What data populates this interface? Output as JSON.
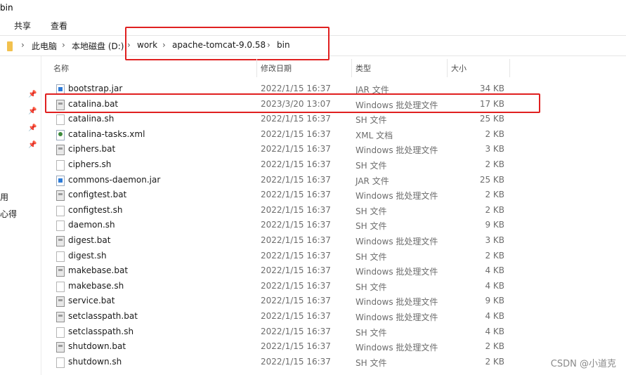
{
  "window": {
    "title": "bin"
  },
  "ribbon": {
    "tabs": [
      "共享",
      "查看"
    ]
  },
  "address": {
    "crumbs": [
      "此电脑",
      "本地磁盘 (D:)",
      "work",
      "apache-tomcat-9.0.58",
      "bin"
    ]
  },
  "nav": {
    "labels": [
      "用",
      "心得"
    ]
  },
  "columns": {
    "name": "名称",
    "date": "修改日期",
    "type": "类型",
    "size": "大小"
  },
  "files": [
    {
      "name": "bootstrap.jar",
      "date": "2022/1/15 16:37",
      "type": "JAR 文件",
      "size": "34 KB",
      "icon": "jar"
    },
    {
      "name": "catalina.bat",
      "date": "2023/3/20 13:07",
      "type": "Windows 批处理文件",
      "size": "17 KB",
      "icon": "bat"
    },
    {
      "name": "catalina.sh",
      "date": "2022/1/15 16:37",
      "type": "SH 文件",
      "size": "25 KB",
      "icon": "sh"
    },
    {
      "name": "catalina-tasks.xml",
      "date": "2022/1/15 16:37",
      "type": "XML 文档",
      "size": "2 KB",
      "icon": "xml"
    },
    {
      "name": "ciphers.bat",
      "date": "2022/1/15 16:37",
      "type": "Windows 批处理文件",
      "size": "3 KB",
      "icon": "bat"
    },
    {
      "name": "ciphers.sh",
      "date": "2022/1/15 16:37",
      "type": "SH 文件",
      "size": "2 KB",
      "icon": "sh"
    },
    {
      "name": "commons-daemon.jar",
      "date": "2022/1/15 16:37",
      "type": "JAR 文件",
      "size": "25 KB",
      "icon": "jar"
    },
    {
      "name": "configtest.bat",
      "date": "2022/1/15 16:37",
      "type": "Windows 批处理文件",
      "size": "2 KB",
      "icon": "bat"
    },
    {
      "name": "configtest.sh",
      "date": "2022/1/15 16:37",
      "type": "SH 文件",
      "size": "2 KB",
      "icon": "sh"
    },
    {
      "name": "daemon.sh",
      "date": "2022/1/15 16:37",
      "type": "SH 文件",
      "size": "9 KB",
      "icon": "sh"
    },
    {
      "name": "digest.bat",
      "date": "2022/1/15 16:37",
      "type": "Windows 批处理文件",
      "size": "3 KB",
      "icon": "bat"
    },
    {
      "name": "digest.sh",
      "date": "2022/1/15 16:37",
      "type": "SH 文件",
      "size": "2 KB",
      "icon": "sh"
    },
    {
      "name": "makebase.bat",
      "date": "2022/1/15 16:37",
      "type": "Windows 批处理文件",
      "size": "4 KB",
      "icon": "bat"
    },
    {
      "name": "makebase.sh",
      "date": "2022/1/15 16:37",
      "type": "SH 文件",
      "size": "4 KB",
      "icon": "sh"
    },
    {
      "name": "service.bat",
      "date": "2022/1/15 16:37",
      "type": "Windows 批处理文件",
      "size": "9 KB",
      "icon": "bat"
    },
    {
      "name": "setclasspath.bat",
      "date": "2022/1/15 16:37",
      "type": "Windows 批处理文件",
      "size": "4 KB",
      "icon": "bat"
    },
    {
      "name": "setclasspath.sh",
      "date": "2022/1/15 16:37",
      "type": "SH 文件",
      "size": "4 KB",
      "icon": "sh"
    },
    {
      "name": "shutdown.bat",
      "date": "2022/1/15 16:37",
      "type": "Windows 批处理文件",
      "size": "2 KB",
      "icon": "bat"
    },
    {
      "name": "shutdown.sh",
      "date": "2022/1/15 16:37",
      "type": "SH 文件",
      "size": "2 KB",
      "icon": "sh"
    }
  ],
  "watermark": "CSDN @小道克",
  "colors": {
    "annotation": "#e02020",
    "folder": "#f2c14e"
  }
}
